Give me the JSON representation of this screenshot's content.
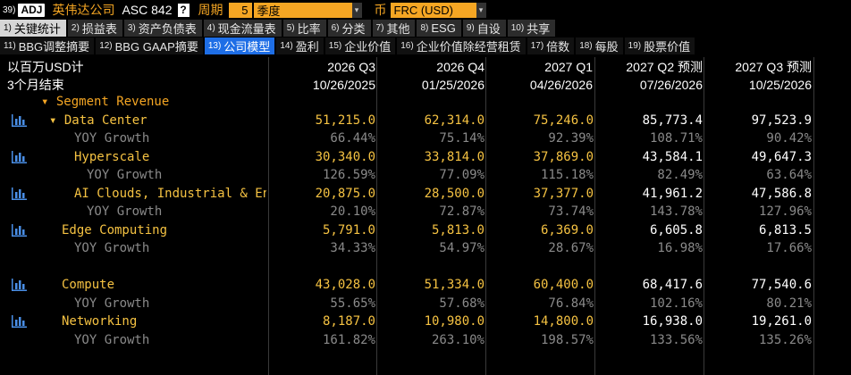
{
  "topbar": {
    "number": "39)",
    "adj": "ADJ",
    "company": "英伟达公司",
    "ticker": "ASC 842",
    "help": "?",
    "period_label": "周期",
    "period_num": "5",
    "period_value": "季度",
    "currency_label": "币",
    "currency_value": "FRC (USD)"
  },
  "tabs1": [
    {
      "n": "1)",
      "label": "关键统计",
      "active": true
    },
    {
      "n": "2)",
      "label": "损益表"
    },
    {
      "n": "3)",
      "label": "资产负债表"
    },
    {
      "n": "4)",
      "label": "现金流量表"
    },
    {
      "n": "5)",
      "label": "比率"
    },
    {
      "n": "6)",
      "label": "分类"
    },
    {
      "n": "7)",
      "label": "其他"
    },
    {
      "n": "8)",
      "label": "ESG"
    },
    {
      "n": "9)",
      "label": "自设"
    },
    {
      "n": "10)",
      "label": "共享"
    }
  ],
  "tabs2": [
    {
      "n": "11)",
      "label": "BBG调整摘要"
    },
    {
      "n": "12)",
      "label": "BBG GAAP摘要"
    },
    {
      "n": "13)",
      "label": "公司模型",
      "active": true
    },
    {
      "n": "14)",
      "label": "盈利"
    },
    {
      "n": "15)",
      "label": "企业价值"
    },
    {
      "n": "16)",
      "label": "企业价值除经营租赁"
    },
    {
      "n": "17)",
      "label": "倍数"
    },
    {
      "n": "18)",
      "label": "每股"
    },
    {
      "n": "19)",
      "label": "股票价值"
    }
  ],
  "header": {
    "unit": "以百万USD计",
    "period": "3个月结束",
    "columns": [
      {
        "title": "2026 Q3",
        "date": "10/26/2025"
      },
      {
        "title": "2026 Q4",
        "date": "01/25/2026"
      },
      {
        "title": "2027 Q1",
        "date": "04/26/2026"
      },
      {
        "title": "2027 Q2 预测",
        "date": "07/26/2026"
      },
      {
        "title": "2027 Q3 预测",
        "date": "10/25/2026"
      }
    ]
  },
  "rows": [
    {
      "label": "▾ Segment Revenue",
      "style": "orange",
      "indent": 46,
      "icon": false,
      "values": [
        "",
        "",
        "",
        "",
        ""
      ]
    },
    {
      "label": "▾ Data Center",
      "style": "yellow",
      "indent": 55,
      "icon": true,
      "values": [
        "51,215.0",
        "62,314.0",
        "75,246.0",
        "85,773.4",
        "97,523.9"
      ],
      "vstyle": [
        "y",
        "y",
        "y",
        "w",
        "w"
      ]
    },
    {
      "label": "YOY Growth",
      "style": "gray",
      "indent": 83,
      "icon": false,
      "values": [
        "66.44%",
        "75.14%",
        "92.39%",
        "108.71%",
        "90.42%"
      ],
      "vstyle": [
        "g",
        "g",
        "g",
        "g",
        "g"
      ]
    },
    {
      "label": "Hyperscale",
      "style": "yellow",
      "indent": 83,
      "icon": true,
      "values": [
        "30,340.0",
        "33,814.0",
        "37,869.0",
        "43,584.1",
        "49,647.3"
      ],
      "vstyle": [
        "y",
        "y",
        "y",
        "w",
        "w"
      ]
    },
    {
      "label": "YOY Growth",
      "style": "gray",
      "indent": 97,
      "icon": false,
      "values": [
        "126.59%",
        "77.09%",
        "115.18%",
        "82.49%",
        "63.64%"
      ],
      "vstyle": [
        "g",
        "g",
        "g",
        "g",
        "g"
      ]
    },
    {
      "label": "AI Clouds, Industrial & Enter…",
      "style": "yellow",
      "indent": 83,
      "icon": true,
      "values": [
        "20,875.0",
        "28,500.0",
        "37,377.0",
        "41,961.2",
        "47,586.8"
      ],
      "vstyle": [
        "y",
        "y",
        "y",
        "w",
        "w"
      ]
    },
    {
      "label": "YOY Growth",
      "style": "gray",
      "indent": 97,
      "icon": false,
      "values": [
        "20.10%",
        "72.87%",
        "73.74%",
        "143.78%",
        "127.96%"
      ],
      "vstyle": [
        "g",
        "g",
        "g",
        "g",
        "g"
      ]
    },
    {
      "label": "Edge Computing",
      "style": "yellow",
      "indent": 69,
      "icon": true,
      "values": [
        "5,791.0",
        "5,813.0",
        "6,369.0",
        "6,605.8",
        "6,813.5"
      ],
      "vstyle": [
        "y",
        "y",
        "y",
        "w",
        "w"
      ]
    },
    {
      "label": "YOY Growth",
      "style": "gray",
      "indent": 83,
      "icon": false,
      "values": [
        "34.33%",
        "54.97%",
        "28.67%",
        "16.98%",
        "17.66%"
      ],
      "vstyle": [
        "g",
        "g",
        "g",
        "g",
        "g"
      ]
    },
    {
      "label": "",
      "style": "gray",
      "indent": 0,
      "icon": false,
      "values": [
        "",
        "",
        "",
        "",
        ""
      ],
      "spacer": true
    },
    {
      "label": "Compute",
      "style": "yellow",
      "indent": 69,
      "icon": true,
      "values": [
        "43,028.0",
        "51,334.0",
        "60,400.0",
        "68,417.6",
        "77,540.6"
      ],
      "vstyle": [
        "y",
        "y",
        "y",
        "w",
        "w"
      ]
    },
    {
      "label": "YOY Growth",
      "style": "gray",
      "indent": 83,
      "icon": false,
      "values": [
        "55.65%",
        "57.68%",
        "76.84%",
        "102.16%",
        "80.21%"
      ],
      "vstyle": [
        "g",
        "g",
        "g",
        "g",
        "g"
      ]
    },
    {
      "label": "Networking",
      "style": "yellow",
      "indent": 69,
      "icon": true,
      "values": [
        "8,187.0",
        "10,980.0",
        "14,800.0",
        "16,938.0",
        "19,261.0"
      ],
      "vstyle": [
        "y",
        "y",
        "y",
        "w",
        "w"
      ]
    },
    {
      "label": "YOY Growth",
      "style": "gray",
      "indent": 83,
      "icon": false,
      "values": [
        "161.82%",
        "263.10%",
        "198.57%",
        "133.56%",
        "135.26%"
      ],
      "vstyle": [
        "g",
        "g",
        "g",
        "g",
        "g"
      ]
    }
  ]
}
